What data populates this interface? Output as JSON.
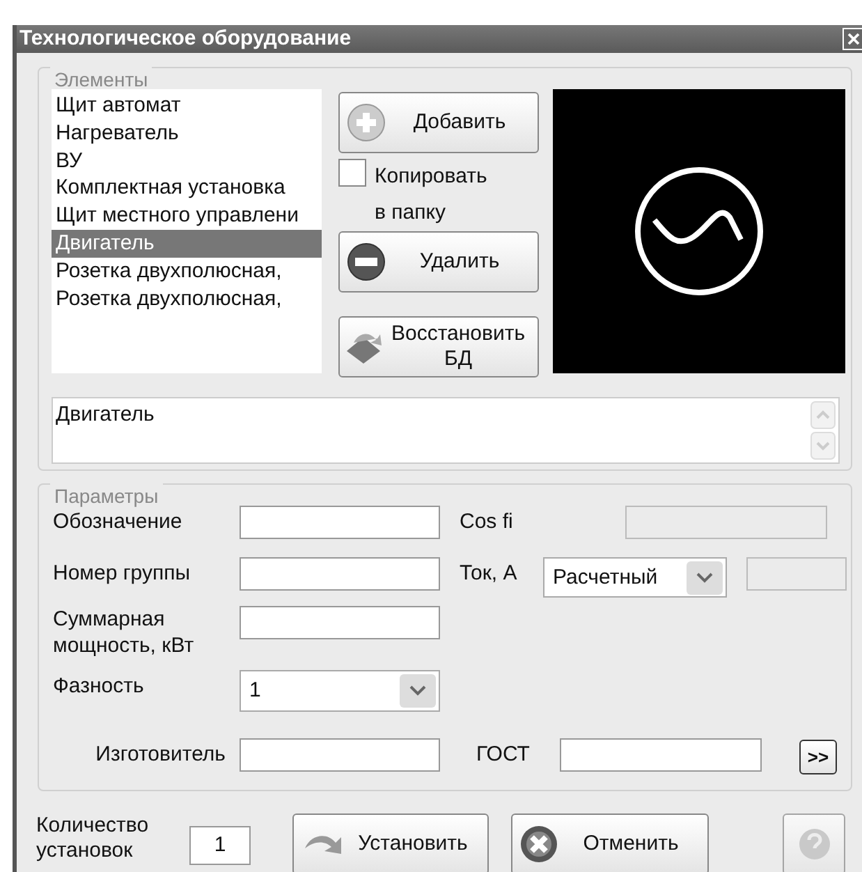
{
  "window": {
    "title": "Технологическое оборудование"
  },
  "elements": {
    "legend": "Элементы",
    "items": [
      {
        "label": "Щит автомат",
        "selected": false
      },
      {
        "label": "Нагреватель",
        "selected": false
      },
      {
        "label": "ВУ",
        "selected": false
      },
      {
        "label": "Комплектная установка",
        "selected": false
      },
      {
        "label": "Щит местного управлени",
        "selected": false
      },
      {
        "label": "Двигатель",
        "selected": true
      },
      {
        "label": "Розетка двухполюсная,",
        "selected": false
      },
      {
        "label": "Розетка двухполюсная,",
        "selected": false
      }
    ],
    "add_button": {
      "label": "Добавить"
    },
    "copy_checkbox": {
      "label_lines": [
        "Копировать",
        "в папку"
      ],
      "checked": false
    },
    "delete_button": {
      "label": "Удалить"
    },
    "restore_button": {
      "label_lines": [
        "Восстановить",
        "БД"
      ]
    },
    "memo": {
      "text": "Двигатель"
    }
  },
  "parameters": {
    "legend": "Параметры",
    "designation": {
      "label": "Обозначение",
      "disabled": false
    },
    "cos_fi": {
      "label": "Cos fi",
      "disabled": true
    },
    "group_number": {
      "label": "Номер группы",
      "disabled": false
    },
    "current": {
      "label": "Ток, А",
      "select": "Расчетный",
      "field_disabled": true
    },
    "total_power": {
      "label_lines": [
        "Суммарная",
        "мощность, кВт"
      ],
      "disabled": false
    },
    "phases": {
      "label": "Фазность",
      "select": "1"
    },
    "manufacturer": {
      "label": "Изготовитель",
      "disabled": false
    },
    "gost": {
      "label": "ГОСТ",
      "disabled": false
    },
    "more_button": {
      "label": ">>"
    }
  },
  "footer": {
    "count_label_lines": [
      "Количество",
      "установок"
    ],
    "count": "1",
    "install_button": {
      "label": "Установить"
    },
    "cancel_button": {
      "label": "Отменить"
    },
    "help_button": {
      "disabled": true
    }
  }
}
